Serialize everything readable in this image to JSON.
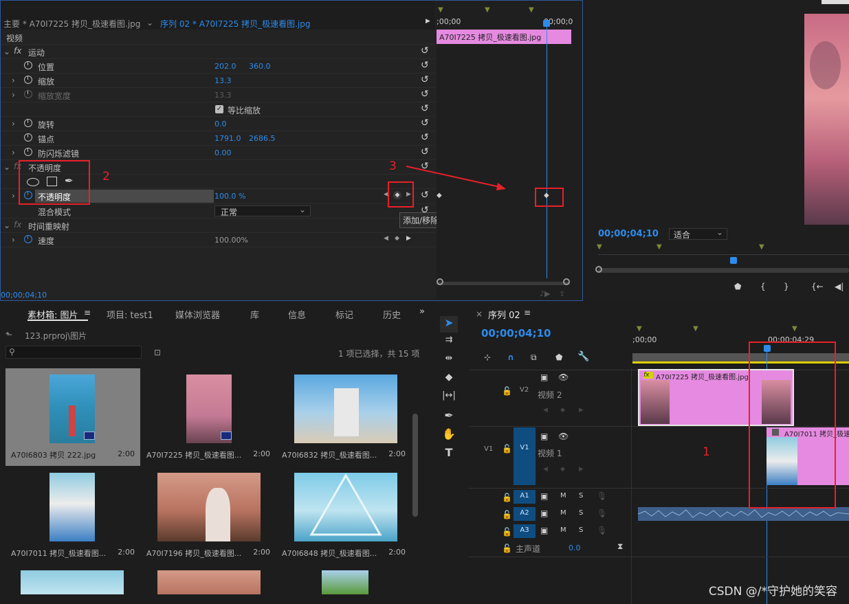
{
  "effect_controls": {
    "source_label": "主要 * A70I7225 拷贝_极速看图.jpg",
    "sequence_tab": "序列 02 * A70I7225 拷贝_极速看图.jpg",
    "section_video": "视频",
    "motion": {
      "label": "运动",
      "rows": [
        {
          "label": "位置",
          "v1": "202.0",
          "v2": "360.0"
        },
        {
          "label": "缩放",
          "v1": "13.3"
        },
        {
          "label": "缩放宽度",
          "v1": "13.3"
        },
        {
          "label": "等比缩放"
        },
        {
          "label": "旋转",
          "v1": "0.0"
        },
        {
          "label": "锚点",
          "v1": "1791.0",
          "v2": "2686.5"
        },
        {
          "label": "防闪烁滤镜",
          "v1": "0.00"
        }
      ]
    },
    "opacity": {
      "label": "不透明度",
      "row_label": "不透明度",
      "value": "100.0 %",
      "blend_label": "混合模式",
      "blend_value": "正常"
    },
    "time_remap": {
      "label": "时间重映射",
      "row_label": "速度",
      "value": "100.00%"
    },
    "tooltip": "添加/移除关键帧",
    "timecode": "00;00;04;10",
    "mini_timeline": {
      "start": ";00;00",
      "end": "00;00;0",
      "clip_label": "A70I7225 拷贝_极速看图.jpg"
    },
    "annotations": {
      "a2": "2",
      "a3": "3"
    }
  },
  "program_monitor": {
    "timecode": "00;00;04;10",
    "fit_label": "适合"
  },
  "bin": {
    "tabs": [
      "素材箱: 图片",
      "项目: test1",
      "媒体浏览器",
      "库",
      "信息",
      "标记",
      "历史"
    ],
    "path": "123.prproj\\图片",
    "status": "1 项已选择，共 15 项",
    "items": [
      {
        "name": "A70I6803 拷贝 222.jpg",
        "duration": "2:00"
      },
      {
        "name": "A70I7225 拷贝_极速看图...",
        "duration": "2:00"
      },
      {
        "name": "A70I6832 拷贝_极速看图...",
        "duration": "2:00"
      },
      {
        "name": "A70I7011 拷贝_极速看图...",
        "duration": "2:00"
      },
      {
        "name": "A70I7196 拷贝_极速看图...",
        "duration": "2:00"
      },
      {
        "name": "A70I6848 拷贝_极速看图...",
        "duration": "2:00"
      }
    ]
  },
  "timeline": {
    "title": "序列 02",
    "timecode": "00;00;04;10",
    "ruler": {
      "start": ";00;00",
      "mark": "00;00;04;29"
    },
    "tracks": {
      "v2": {
        "id": "V2",
        "name": "视频 2"
      },
      "v1": {
        "id": "V1",
        "src": "V1",
        "name": "视频 1"
      },
      "a1": {
        "id": "A1"
      },
      "a2": {
        "id": "A2"
      },
      "a3": {
        "id": "A3"
      },
      "master": {
        "label": "主声道",
        "value": "0.0"
      },
      "m": "M",
      "s": "S"
    },
    "clip_v2": "A70I7225 拷贝_极速看图.jpg",
    "clip_v1": "A70I7011 拷贝_极速",
    "annotation_1": "1"
  },
  "watermark": "CSDN @/*守护她的笑容",
  "colors": {
    "accent": "#2d8ceb",
    "clip_pink": "#e58ae0",
    "annotation_red": "#e8202a",
    "track_blue": "#0f4d80"
  }
}
